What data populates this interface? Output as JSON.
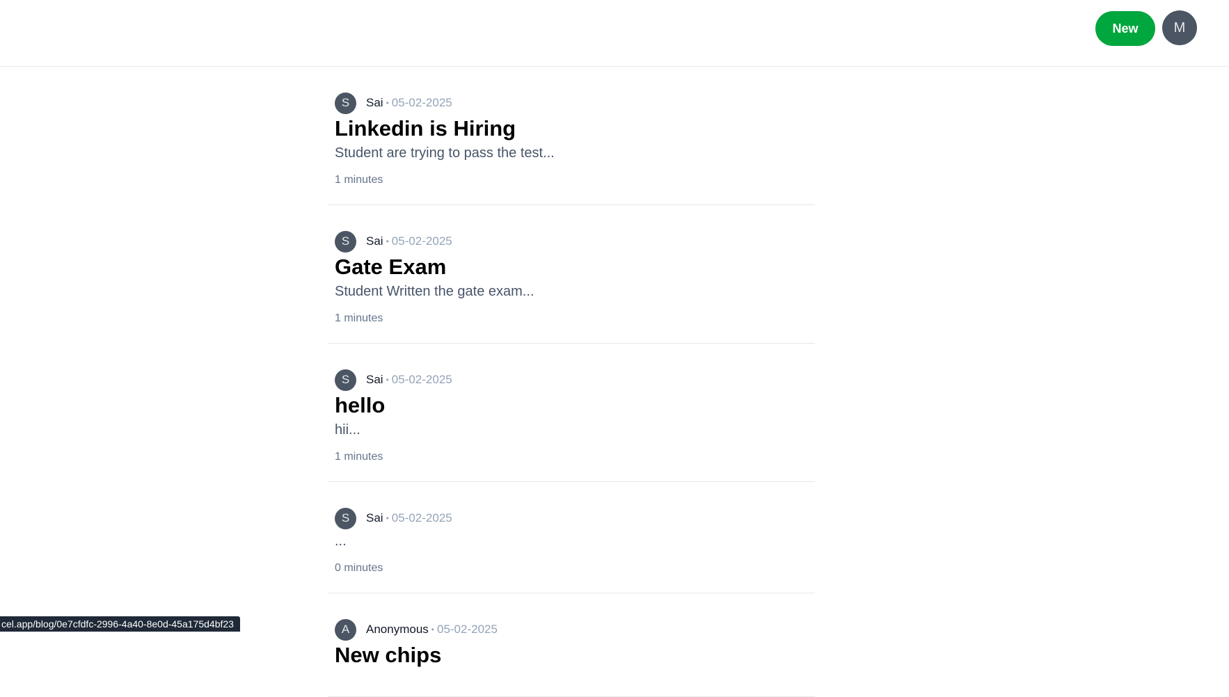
{
  "header": {
    "new_button_label": "New",
    "user_initial": "M"
  },
  "posts": [
    {
      "author_initial": "S",
      "author": "Sai",
      "date": "05-02-2025",
      "title": "Linkedin is Hiring",
      "excerpt": "Student are trying to pass the test...",
      "read_time": "1 minutes"
    },
    {
      "author_initial": "S",
      "author": "Sai",
      "date": "05-02-2025",
      "title": "Gate Exam",
      "excerpt": "Student Written the gate exam...",
      "read_time": "1 minutes"
    },
    {
      "author_initial": "S",
      "author": "Sai",
      "date": "05-02-2025",
      "title": "hello",
      "excerpt": "hii...",
      "read_time": "1 minutes"
    },
    {
      "author_initial": "S",
      "author": "Sai",
      "date": "05-02-2025",
      "title": "",
      "excerpt": "...",
      "read_time": "0 minutes"
    },
    {
      "author_initial": "A",
      "author": "Anonymous",
      "date": "05-02-2025",
      "title": "New chips",
      "excerpt": "",
      "read_time": ""
    }
  ],
  "separator": "•",
  "status_bar": {
    "url": "cel.app/blog/0e7cfdfc-2996-4a40-8e0d-45a175d4bf23"
  }
}
